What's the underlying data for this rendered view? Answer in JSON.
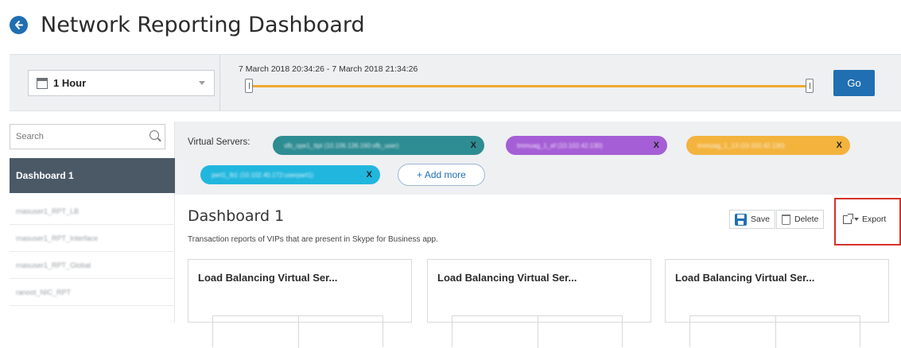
{
  "header": {
    "title": "Network Reporting Dashboard"
  },
  "timebar": {
    "duration": "1 Hour",
    "range": "7 March 2018 20:34:26 - 7 March 2018 21:34:26",
    "go_label": "Go"
  },
  "sidebar": {
    "search_placeholder": "Search",
    "active_item": "Dashboard 1",
    "items": [
      "rnasuser1_RPT_LB",
      "rnasuser1_RPT_Interface",
      "rnasuser1_RPT_Global",
      "ranoot_NIC_RPT"
    ]
  },
  "filters": {
    "label": "Virtual Servers:",
    "chips": [
      {
        "text": "sfb_ope1_ttpt (10.106.136.160:sfb_user)",
        "color": "#2e8c93"
      },
      {
        "text": "tmmuag_1_ef (10.102.42.130)",
        "color": "#a55ed6"
      },
      {
        "text": "tmmuag_1_13 (10.102.42.130)",
        "color": "#f3b33d"
      },
      {
        "text": "pert1_lb1 (10.102.40.172:userpart1)",
        "color": "#21b6de"
      }
    ],
    "chip_close": "X",
    "add_more_label": "+ Add more"
  },
  "dashboard": {
    "title": "Dashboard 1",
    "description": "Transaction reports of VIPs that are present in Skype for Business app.",
    "save_label": "Save",
    "delete_label": "Delete",
    "export_label": "Export"
  },
  "cards": [
    {
      "title": "Load Balancing Virtual Ser..."
    },
    {
      "title": "Load Balancing Virtual Ser..."
    },
    {
      "title": "Load Balancing Virtual Ser..."
    }
  ],
  "colors": {
    "accent": "#1f6fb2",
    "slider": "#f0a92e",
    "highlight": "#d6322b",
    "nav_active": "#4b5967"
  }
}
